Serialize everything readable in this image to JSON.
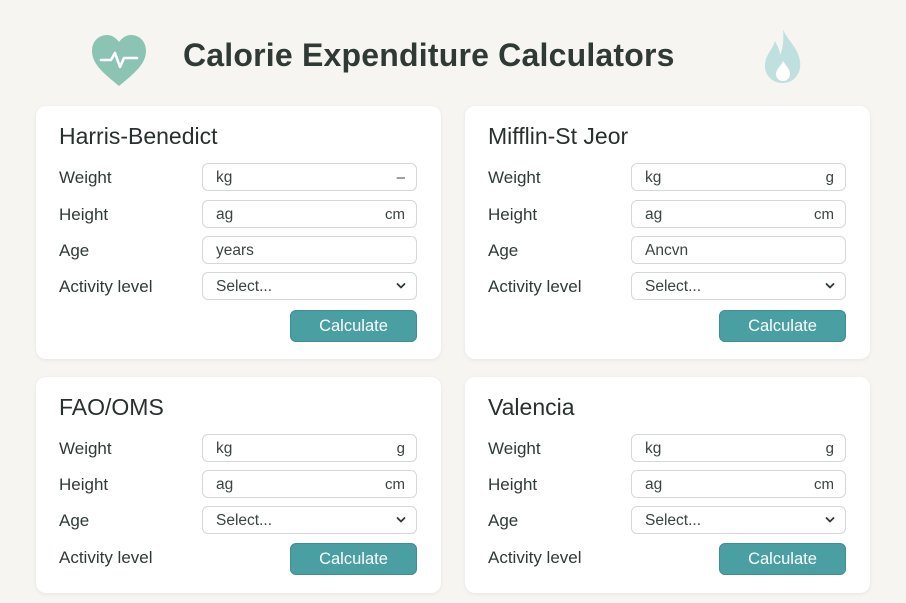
{
  "header": {
    "title": "Calorie Expenditure Calculators",
    "heart_icon": "heart-pulse-icon",
    "flame_icon": "flame-icon"
  },
  "colors": {
    "background": "#f6f5f1",
    "accent": "#4a9fa3",
    "heart": "#8cc4b4",
    "flame": "#bfe0de"
  },
  "cards": [
    {
      "title": "Harris-Benedict",
      "weight_label": "Weight",
      "weight_placeholder": "kg",
      "weight_unit": "–",
      "height_label": "Height",
      "height_placeholder": "ag",
      "height_unit": "cm",
      "age_label": "Age",
      "age_placeholder": "years",
      "activity_label": "Activity level",
      "activity_select": "Select...",
      "button": "Calculate"
    },
    {
      "title": "Mifflin-St Jeor",
      "weight_label": "Weight",
      "weight_placeholder": "kg",
      "weight_unit": "g",
      "height_label": "Height",
      "height_placeholder": "ag",
      "height_unit": "cm",
      "age_label": "Age",
      "age_placeholder": "Ancvn",
      "activity_label": "Activity level",
      "activity_select": "Select...",
      "button": "Calculate"
    },
    {
      "title": "FAO/OMS",
      "weight_label": "Weight",
      "weight_placeholder": "kg",
      "weight_unit": "g",
      "height_label": "Height",
      "height_placeholder": "ag",
      "height_unit": "cm",
      "age_label": "Age",
      "age_select": "Select...",
      "activity_label": "Activity level",
      "button": "Calculate"
    },
    {
      "title": "Valencia",
      "weight_label": "Weight",
      "weight_placeholder": "kg",
      "weight_unit": "g",
      "height_label": "Height",
      "height_placeholder": "ag",
      "height_unit": "cm",
      "age_label": "Age",
      "age_select": "Select...",
      "activity_label": "Activity level",
      "button": "Calculate"
    }
  ]
}
